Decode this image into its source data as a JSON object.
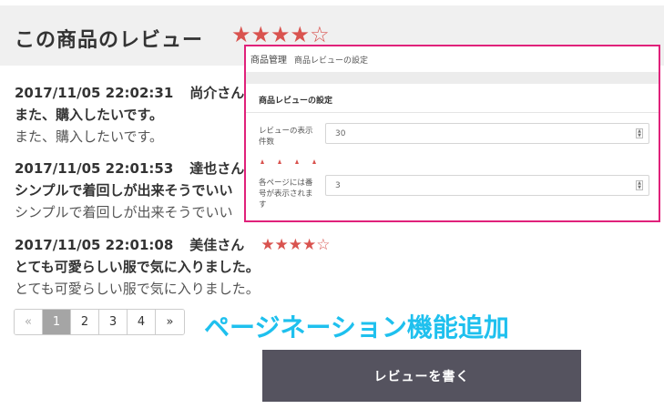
{
  "header": {
    "title": "この商品のレビュー",
    "stars": "★★★★☆"
  },
  "reviews": [
    {
      "datetime": "2017/11/05 22:02:31",
      "name": "尚介さん",
      "stars": "",
      "title": "また、購入したいです。",
      "body": "また、購入したいです。"
    },
    {
      "datetime": "2017/11/05 22:01:53",
      "name": "達也さん",
      "stars": "",
      "title": "シンプルで着回しが出来そうでいい",
      "body": "シンプルで着回しが出来そうでいい"
    },
    {
      "datetime": "2017/11/05 22:01:08",
      "name": "美佳さん",
      "stars": "★★★★☆",
      "title": "とても可愛らしい服で気に入りました。",
      "body": "とても可愛らしい服で気に入りました。"
    }
  ],
  "pagination": {
    "prev": "«",
    "pages": [
      "1",
      "2",
      "3",
      "4"
    ],
    "next": "»",
    "active_page": "1"
  },
  "feature_label": "ページネーション機能追加",
  "write_review_button": "レビューを書く",
  "settings_panel": {
    "breadcrumb_main": "商品管理",
    "breadcrumb_sub": "商品レビューの設定",
    "section_title": "商品レビューの設定",
    "fields": [
      {
        "label": "レビューの表示件数",
        "value": "30"
      },
      {
        "label": "各ページには番号が表示されます",
        "value": "3"
      }
    ],
    "accent_color": "#e0217a"
  }
}
